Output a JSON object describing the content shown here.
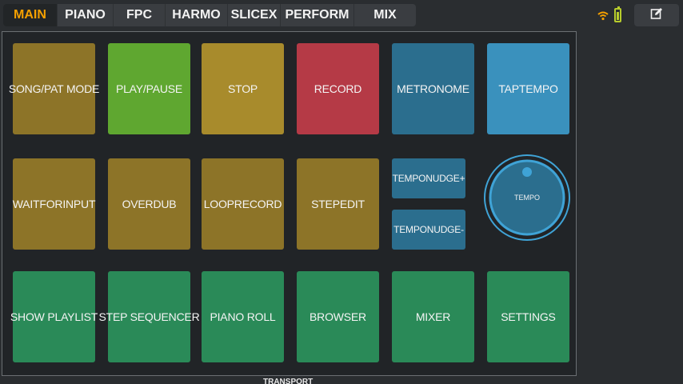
{
  "tabs": [
    {
      "label": "MAIN",
      "active": true
    },
    {
      "label": "PIANO",
      "active": false
    },
    {
      "label": "FPC",
      "active": false
    },
    {
      "label": "HARMO",
      "active": false
    },
    {
      "label": "SLICEX",
      "active": false
    },
    {
      "label": "PERFORM",
      "active": false
    },
    {
      "label": "MIX",
      "active": false
    }
  ],
  "status": {
    "wifi_icon": "wifi-icon",
    "battery_icon": "battery-icon"
  },
  "edit_icon": "edit-icon",
  "pads": {
    "row1": [
      {
        "label": "SONG/PAT MODE",
        "color": "#8d7428"
      },
      {
        "label": "PLAY/PAUSE",
        "color": "#5fa730"
      },
      {
        "label": "STOP",
        "color": "#a88b2c"
      },
      {
        "label": "RECORD",
        "color": "#b53a46"
      },
      {
        "label": "METRONOME",
        "color": "#2b6e8e"
      },
      {
        "label": "TAPTEMPO",
        "color": "#3a91bd"
      }
    ],
    "row2": [
      {
        "label": "WAITFORINPUT",
        "color": "#8d7428"
      },
      {
        "label": "OVERDUB",
        "color": "#8d7428"
      },
      {
        "label": "LOOPRECORD",
        "color": "#8d7428"
      },
      {
        "label": "STEPEDIT",
        "color": "#8d7428"
      }
    ],
    "nudge": [
      {
        "label": "TEMPONUDGE+",
        "color": "#2b6e8e"
      },
      {
        "label": "TEMPONUDGE-",
        "color": "#2b6e8e"
      }
    ],
    "row3": [
      {
        "label": "SHOW PLAYLIST",
        "color": "#2a8a58"
      },
      {
        "label": "STEP SEQUENCER",
        "color": "#2a8a58"
      },
      {
        "label": "PIANO ROLL",
        "color": "#2a8a58"
      },
      {
        "label": "BROWSER",
        "color": "#2a8a58"
      },
      {
        "label": "MIXER",
        "color": "#2a8a58"
      },
      {
        "label": "SETTINGS",
        "color": "#2a8a58"
      }
    ]
  },
  "knob": {
    "label": "TEMPO",
    "color": "#2b6e8e",
    "ring_color": "#3fa3d6"
  },
  "footer": {
    "label": "TRANSPORT"
  },
  "colors": {
    "accent": "#f5a000"
  }
}
